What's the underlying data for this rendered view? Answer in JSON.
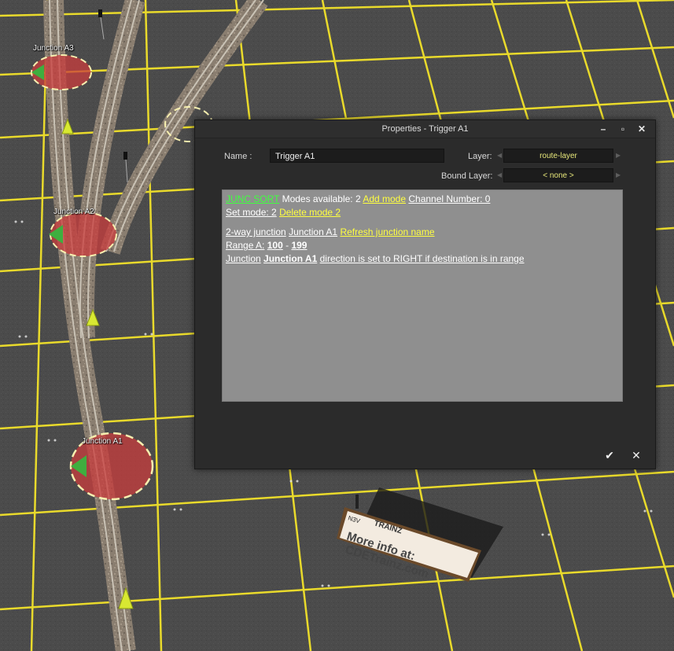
{
  "scene": {
    "junction_labels": [
      "Junction A3",
      "Junction A2",
      "Junction A1"
    ],
    "sign": {
      "badge": "N3V",
      "brand": "TRAINZ",
      "line1": "More info at:",
      "line2": "CDETrainz.com"
    }
  },
  "dialog": {
    "title": "Properties - Trigger A1",
    "window_buttons": {
      "minimize": "–",
      "maximize": "▫",
      "close": "✕"
    },
    "name_label": "Name :",
    "name_value": "Trigger A1",
    "layer_label": "Layer:",
    "layer_value": "route-layer",
    "bound_layer_label": "Bound Layer:",
    "bound_layer_value": "< none >",
    "content": {
      "mode_tag": "JUNC SORT",
      "modes_available": "Modes available: 2",
      "add_mode": "Add mode",
      "channel_number": "Channel Number: 0",
      "set_mode": "Set mode: 2",
      "delete_mode": "Delete mode 2",
      "junction_type": "2-way junction",
      "junction_name": "Junction A1",
      "refresh_junction": "Refresh junction name",
      "range_prefix": "Range A:",
      "range_min": "100",
      "range_sep": "-",
      "range_max": "199",
      "direction_prefix": "Junction",
      "direction_junction": "Junction A1",
      "direction_suffix": "direction is set to RIGHT if destination is in range"
    },
    "ok_button": "✔",
    "cancel_button": "✕"
  },
  "colors": {
    "ground": "#4a4a4a",
    "grid_line": "#f2e22a",
    "dialog_bg": "#2b2b2b",
    "content_bg": "#8f8f8f",
    "link_yellow": "#ffff40",
    "link_green": "#40ff40",
    "dropdown_text": "#e8e87a"
  }
}
